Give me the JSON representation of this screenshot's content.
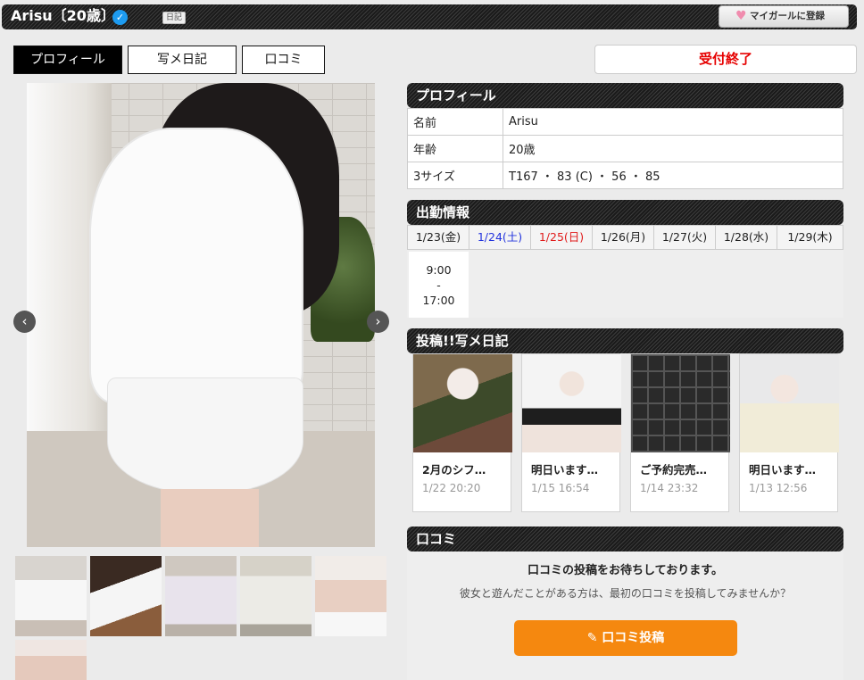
{
  "header": {
    "title": "Arisu〔20歳〕",
    "diary_badge": "日記",
    "mygirl_label": "マイガールに登録"
  },
  "tabs": [
    {
      "label": "プロフィール",
      "active": true
    },
    {
      "label": "写メ日記",
      "active": false
    },
    {
      "label": "口コミ",
      "active": false
    }
  ],
  "status_label": "受付終了",
  "profile": {
    "heading": "プロフィール",
    "rows": [
      {
        "key": "名前",
        "value": "Arisu"
      },
      {
        "key": "年齢",
        "value": "20歳"
      },
      {
        "key": "3サイズ",
        "value": "T167 ・ 83 (C) ・ 56 ・ 85"
      }
    ]
  },
  "schedule": {
    "heading": "出勤情報",
    "days": [
      {
        "label": "1/23(金)",
        "kind": "weekday"
      },
      {
        "label": "1/24(土)",
        "kind": "sat"
      },
      {
        "label": "1/25(日)",
        "kind": "sun"
      },
      {
        "label": "1/26(月)",
        "kind": "weekday"
      },
      {
        "label": "1/27(火)",
        "kind": "weekday"
      },
      {
        "label": "1/28(水)",
        "kind": "weekday"
      },
      {
        "label": "1/29(木)",
        "kind": "weekday"
      }
    ],
    "first_shift": {
      "start": "9:00",
      "sep": "-",
      "end": "17:00"
    }
  },
  "diary": {
    "heading": "投稿!!写メ日記",
    "posts": [
      {
        "title": "2月のシフ…",
        "date": "1/22 20:20"
      },
      {
        "title": "明日います…",
        "date": "1/15 16:54"
      },
      {
        "title": "ご予約完売…",
        "date": "1/14 23:32"
      },
      {
        "title": "明日います…",
        "date": "1/13 12:56"
      }
    ]
  },
  "reviews": {
    "heading": "口コミ",
    "waiting": "口コミの投稿をお待ちしております。",
    "invite": "彼女と遊んだことがある方は、最初の口コミを投稿してみませんか？",
    "button_label": "口コミ投稿"
  },
  "colors": {
    "accent_orange": "#f5880f",
    "status_red": "#e60000",
    "saturday_blue": "#2233dd",
    "sunday_red": "#e01b1b",
    "verified_blue": "#1d9bf0"
  },
  "icons": {
    "verified": "verified-check-icon",
    "heart": "heart-icon",
    "prev": "chevron-left-icon",
    "next": "chevron-right-icon",
    "pen": "pen-icon"
  }
}
